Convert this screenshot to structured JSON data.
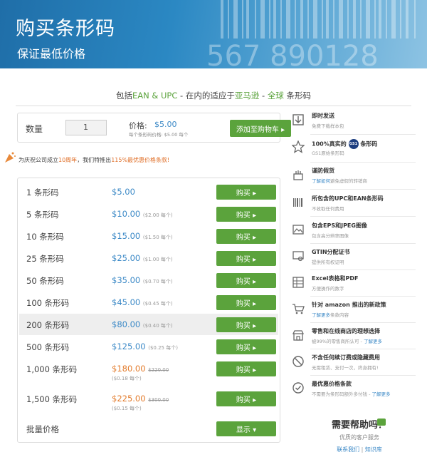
{
  "banner": {
    "title": "购买条形码",
    "subtitle": "保证最低价格",
    "barcode_digits": "567 890128"
  },
  "tagline": {
    "prefix": "包括",
    "codes": "EAN & UPC",
    "mid": " - 在内的适应于",
    "amazon": "亚马逊",
    "dash": " - ",
    "global": "全球",
    "suffix": " 条形码"
  },
  "qty": {
    "label": "数量",
    "value": "1",
    "price_label": "价格:",
    "price_value": "$5.00",
    "unit_note": "每个条形码价格:   $5.00 每个",
    "cart_button": "添加至购物车 ▸"
  },
  "promo": {
    "pre": "为庆祝公司成立",
    "years": "10周年",
    "mid": "，我们特推出",
    "deal": "115%最优惠价格条款!"
  },
  "price_rows": [
    {
      "qty": "1 条形码",
      "price": "$5.00",
      "per": "",
      "button": "购买 ▸"
    },
    {
      "qty": "5 条形码",
      "price": "$10.00",
      "per": "($2.00 每个)",
      "button": "购买 ▸"
    },
    {
      "qty": "10 条形码",
      "price": "$15.00",
      "per": "($1.50 每个)",
      "button": "购买 ▸"
    },
    {
      "qty": "25 条形码",
      "price": "$25.00",
      "per": "($1.00 每个)",
      "button": "购买 ▸"
    },
    {
      "qty": "50 条形码",
      "price": "$35.00",
      "per": "($0.70 每个)",
      "button": "购买 ▸"
    },
    {
      "qty": "100 条形码",
      "price": "$45.00",
      "per": "($0.45 每个)",
      "button": "购买 ▸"
    },
    {
      "qty": "200 条形码",
      "price": "$80.00",
      "per": "($0.40 每个)",
      "button": "购买 ▸"
    },
    {
      "qty": "500 条形码",
      "price": "$125.00",
      "per": "($0.25 每个)",
      "button": "购买 ▸"
    },
    {
      "qty": "1,000 条形码",
      "price": "$180.00",
      "old": "$220.00",
      "per": "($0.18 每个)",
      "button": "购买 ▸"
    },
    {
      "qty": "1,500 条形码",
      "price": "$225.00",
      "old": "$300.00",
      "per": "($0.15 每个)",
      "button": "购买 ▸"
    }
  ],
  "bulk": {
    "label": "批量价格",
    "button": "显示 ▾"
  },
  "features": [
    {
      "title": "即时发送",
      "sub": "免费下载样本包",
      "icon": "download-icon"
    },
    {
      "title": "100%真实的",
      "title2": "GS1",
      "title3": "条形码",
      "sub": "GS1原始条形码",
      "icon": "star-icon"
    },
    {
      "title": "谨防假货",
      "sub_link": "了解如何",
      "sub": "避免虚假的转销商",
      "icon": "cake-icon"
    },
    {
      "title": "所包含的UPC和EAN条形码",
      "sub": "不收取任何费用",
      "icon": "barcode-icon"
    },
    {
      "title": "包含EPS和JPEG图像",
      "sub": "包含高分辨率图像",
      "icon": "image-icon"
    },
    {
      "title": "GTIN分配证书",
      "sub": "提供所有权证明",
      "icon": "certificate-icon"
    },
    {
      "title": "Excel表格和PDF",
      "sub": "方便操作的数字",
      "icon": "spreadsheet-icon"
    },
    {
      "title": "针对 ",
      "title_brand": "amazon",
      "title_rest": " 推出的新政策",
      "sub_link": "了解更多",
      "sub": "条款内容",
      "icon": "cart-icon"
    },
    {
      "title": "零售和在线商店的理想选择",
      "sub": "被99%的零售商所认可 - ",
      "sub_link2": "了解更多",
      "icon": "store-icon"
    },
    {
      "title": "不含任何续订费或隐藏费用",
      "sub": "无需租赁、支付一次，终身拥有!",
      "icon": "no-fee-icon"
    },
    {
      "title": "最优惠价格条款",
      "sub": "不需要为条形码额外多付钱 - ",
      "sub_link2": "了解更多",
      "icon": "check-icon"
    }
  ],
  "help": {
    "title": "需要帮助吗？",
    "sub": "优质的客户服务",
    "contact": "联系我们",
    "sep": " | ",
    "kb": "知识库"
  }
}
